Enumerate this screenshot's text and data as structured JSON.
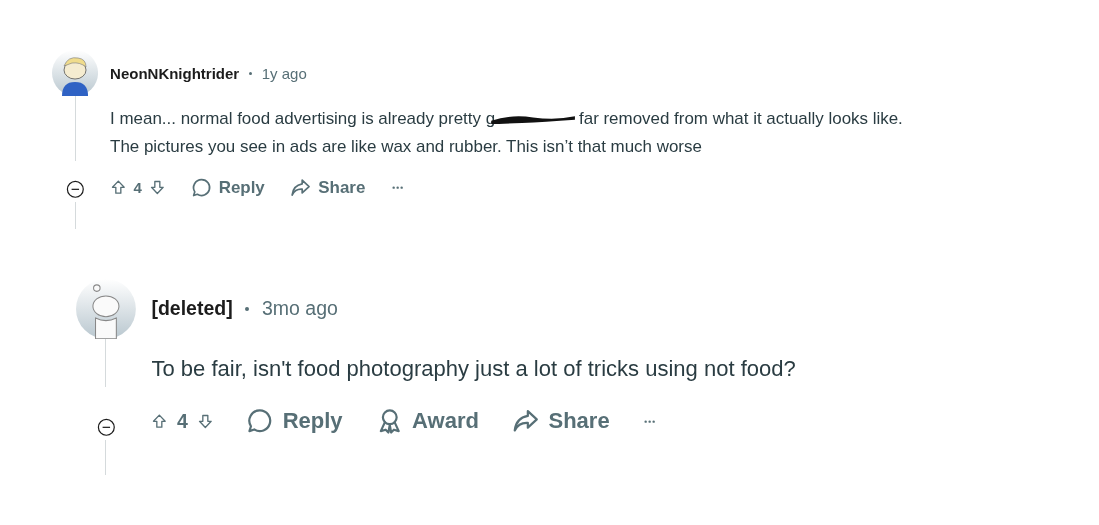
{
  "comments": [
    {
      "author": "NeonNKnightrider",
      "time": "1y ago",
      "avatar": {
        "kind": "cartoon"
      },
      "lines": [
        [
          {
            "kind": "text",
            "text": "I mean... normal food advertising is already pretty g"
          },
          {
            "kind": "redaction"
          },
          {
            "kind": "text",
            "text": "far removed from what it actually looks like."
          }
        ],
        [
          {
            "kind": "text",
            "text": "The pictures you see in ads are like wax and rubber. This isn’t that much worse"
          }
        ]
      ],
      "actions": [
        {
          "kind": "vote",
          "score": "4"
        },
        {
          "kind": "reply",
          "label": "Reply"
        },
        {
          "kind": "share",
          "label": "Share"
        },
        {
          "kind": "more"
        }
      ]
    },
    {
      "author": "[deleted]",
      "time": "3mo ago",
      "avatar": {
        "kind": "blank"
      },
      "lines": [
        [
          {
            "kind": "text",
            "text": "To be fair, isn't food photography just a lot of tricks using not food?"
          }
        ]
      ],
      "actions": [
        {
          "kind": "vote",
          "score": "4"
        },
        {
          "kind": "reply",
          "label": "Reply"
        },
        {
          "kind": "award",
          "label": "Award"
        },
        {
          "kind": "share",
          "label": "Share"
        },
        {
          "kind": "more"
        }
      ]
    }
  ]
}
